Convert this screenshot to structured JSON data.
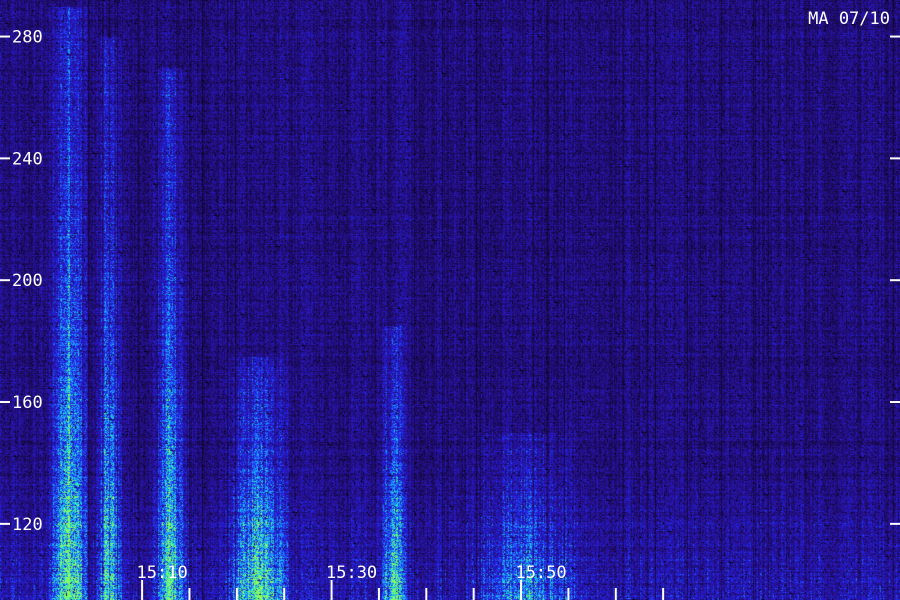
{
  "chart_data": {
    "type": "heatmap",
    "title": "MA 07/10",
    "xlabel": "",
    "ylabel": "",
    "x_tick_labels": [
      "15:10",
      "15:30",
      "15:50"
    ],
    "y_ticks": [
      120,
      160,
      200,
      240,
      280
    ],
    "ylim": [
      95,
      292
    ],
    "xlim_minutes": [
      15.0,
      75.0
    ],
    "x_labeled_ticks_minutes": [
      70,
      90,
      110
    ],
    "x_minor_ticks_minutes": [
      75,
      80,
      85,
      95,
      100,
      105,
      115,
      120,
      125
    ],
    "grid": false,
    "colormap": [
      "#000000",
      "#1a0a55",
      "#2a14a8",
      "#2020e6",
      "#1f6bff",
      "#19b4ff",
      "#1fe6c8",
      "#8cff5a"
    ],
    "emission_bands": [
      {
        "start_min": 60.0,
        "end_min": 64.5,
        "freq_low": 95,
        "freq_high": 290,
        "intensity": 0.85
      },
      {
        "start_min": 65.0,
        "end_min": 68.0,
        "freq_low": 95,
        "freq_high": 280,
        "intensity": 0.75
      },
      {
        "start_min": 71.0,
        "end_min": 75.0,
        "freq_low": 95,
        "freq_high": 270,
        "intensity": 0.7
      },
      {
        "start_min": 78.5,
        "end_min": 86.0,
        "freq_low": 95,
        "freq_high": 175,
        "intensity": 0.75
      },
      {
        "start_min": 95.0,
        "end_min": 98.0,
        "freq_low": 95,
        "freq_high": 185,
        "intensity": 0.7
      },
      {
        "start_min": 104.0,
        "end_min": 117.0,
        "freq_low": 95,
        "freq_high": 150,
        "intensity": 0.4
      }
    ]
  }
}
